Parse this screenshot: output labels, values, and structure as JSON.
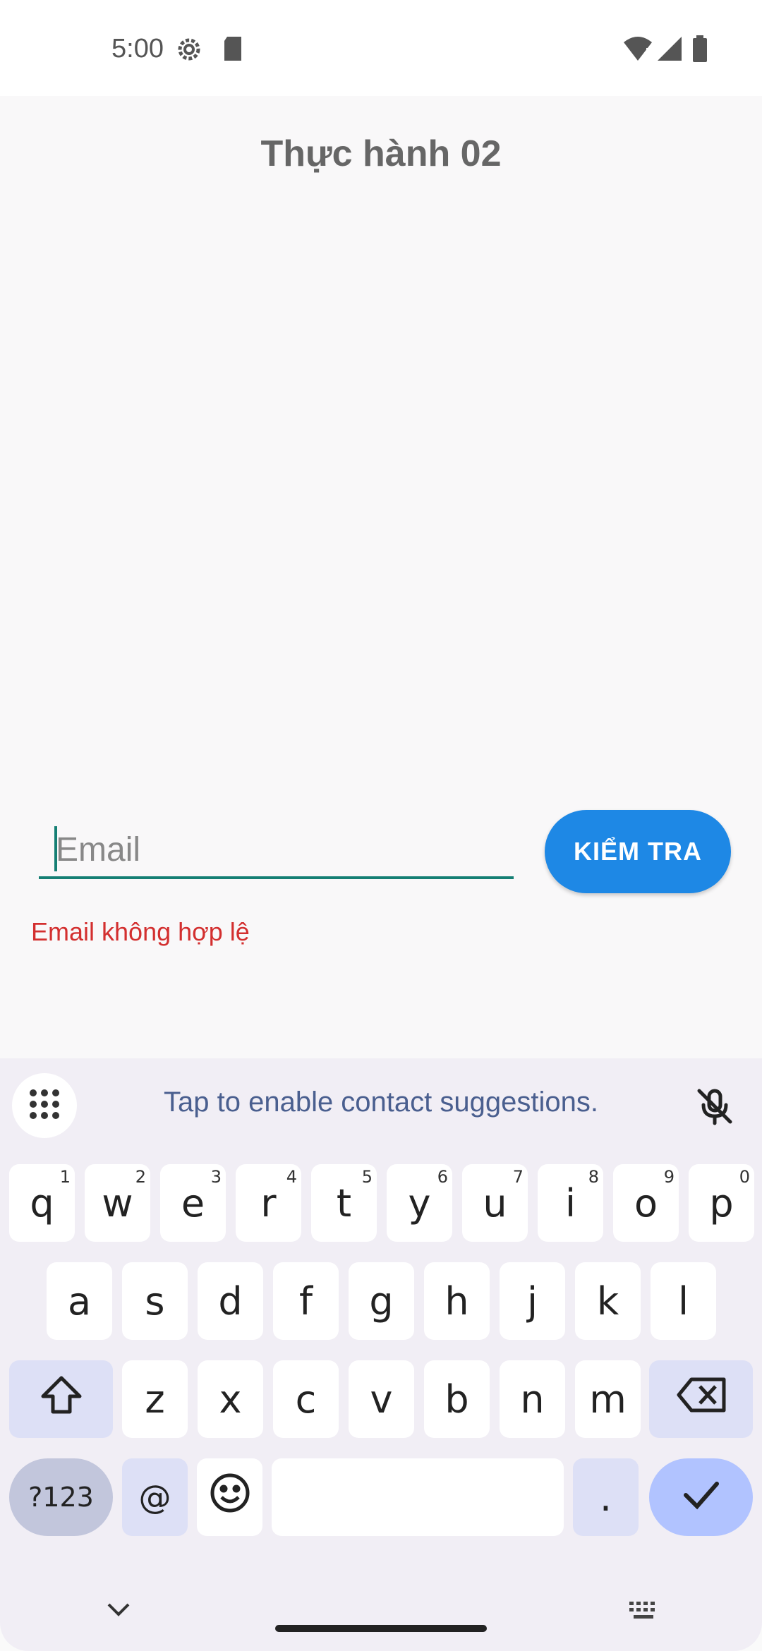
{
  "status_bar": {
    "time": "5:00",
    "icons": [
      "gear-icon",
      "sd-card-icon",
      "wifi-icon",
      "signal-icon",
      "battery-icon"
    ]
  },
  "app": {
    "title": "Thực hành 02",
    "email_placeholder": "Email",
    "check_button_label": "KIỂM TRA",
    "error_message": "Email không hợp lệ",
    "colors": {
      "button": "#1e88e5",
      "underline": "#157f74",
      "error": "#d32f2f"
    }
  },
  "keyboard": {
    "suggestion": "Tap to enable contact suggestions.",
    "row1": [
      {
        "k": "q",
        "h": "1"
      },
      {
        "k": "w",
        "h": "2"
      },
      {
        "k": "e",
        "h": "3"
      },
      {
        "k": "r",
        "h": "4"
      },
      {
        "k": "t",
        "h": "5"
      },
      {
        "k": "y",
        "h": "6"
      },
      {
        "k": "u",
        "h": "7"
      },
      {
        "k": "i",
        "h": "8"
      },
      {
        "k": "o",
        "h": "9"
      },
      {
        "k": "p",
        "h": "0"
      }
    ],
    "row2": [
      "a",
      "s",
      "d",
      "f",
      "g",
      "h",
      "j",
      "k",
      "l"
    ],
    "row3": [
      "z",
      "x",
      "c",
      "v",
      "b",
      "n",
      "m"
    ],
    "symbols_label": "?123",
    "at_label": "@",
    "period_label": "."
  }
}
